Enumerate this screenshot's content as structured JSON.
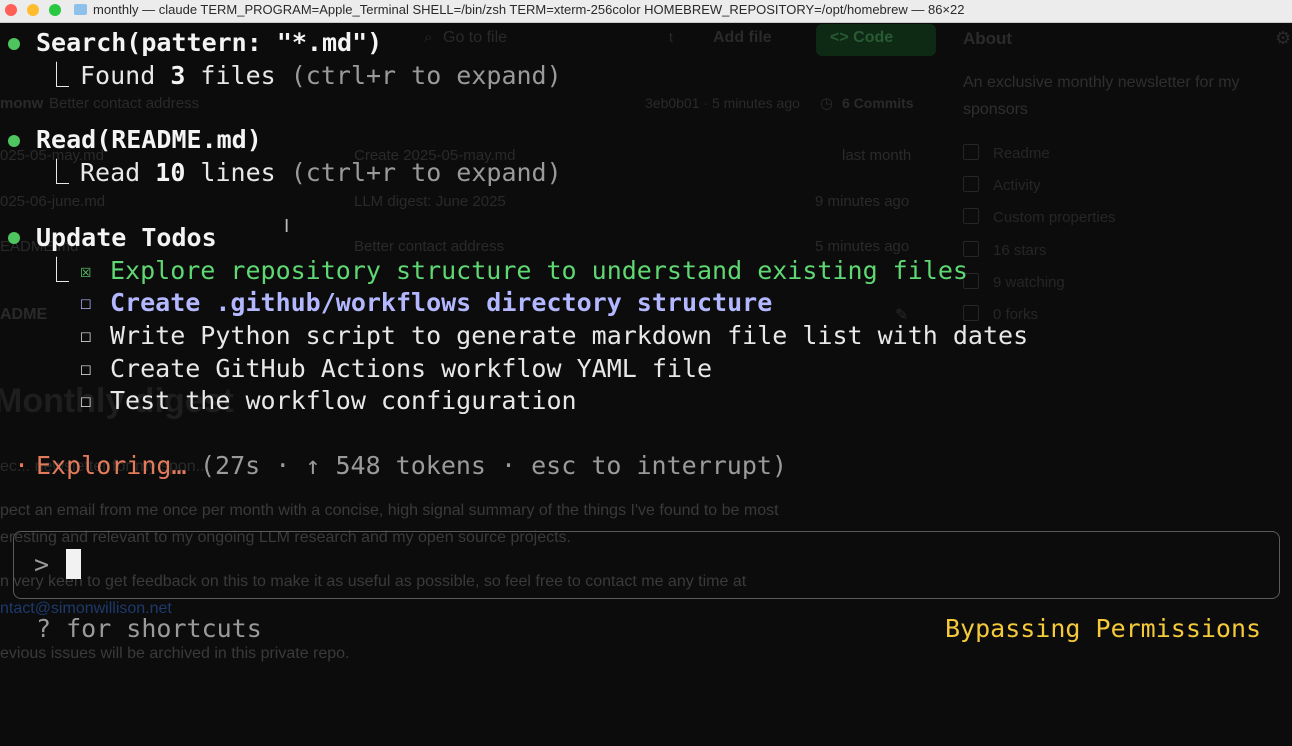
{
  "window": {
    "title": "monthly — claude TERM_PROGRAM=Apple_Terminal SHELL=/bin/zsh TERM=xterm-256color HOMEBREW_REPOSITORY=/opt/homebrew — 86×22"
  },
  "background_github": {
    "go_to_file": "Go to file",
    "shortcut_key": "t",
    "add_file": "Add file",
    "code_button": "<> Code",
    "branch_fragment": "monw",
    "commit_message": "Better contact address",
    "commit_hash_time": "3eb0b01 · 5 minutes ago",
    "commits": "6 Commits",
    "files": [
      {
        "name": "025-05-may.md",
        "message": "Create 2025-05-may.md",
        "time": "last month"
      },
      {
        "name": "025-06-june.md",
        "message": "LLM digest: June 2025",
        "time": "9 minutes ago"
      },
      {
        "name": "EADME.md",
        "message": "Better contact address",
        "time": "5 minutes ago"
      }
    ],
    "readme_tab": "ADME",
    "heading": "Monthly digest",
    "para1_fragment": "ec... newsletter for my spon...",
    "para2a": "pect an email from me once per month with a concise, high signal summary of the things I've found to be most",
    "para2b": "eresting and relevant to my ongoing LLM research and my open source projects.",
    "para3": "n very keen to get feedback on this to make it as useful as possible, so feel free to contact me any time at",
    "email": "ntact@simonwillison.net",
    "para4": "evious issues will be archived in this private repo.",
    "about": {
      "title": "About",
      "description": "An exclusive monthly newsletter for my sponsors",
      "items": [
        "Readme",
        "Activity",
        "Custom properties",
        "16 stars",
        "9 watching",
        "0 forks"
      ]
    }
  },
  "terminal": {
    "search_call": "Search(pattern: \"*.md\")",
    "search_result_prefix": "Found ",
    "search_result_count": "3",
    "search_result_suffix": " files ",
    "search_hint": "(ctrl+r to expand)",
    "read_call": "Read(README.md)",
    "read_result_prefix": "Read ",
    "read_result_count": "10",
    "read_result_suffix": " lines ",
    "read_hint": "(ctrl+r to expand)",
    "todos_title": "Update Todos",
    "tree_glyph": "⎿",
    "checked_box": "☒",
    "unchecked_box": "☐",
    "todos": [
      {
        "text": "Explore repository structure to understand existing files",
        "status": "done"
      },
      {
        "text": "Create .github/workflows directory structure",
        "status": "in_progress"
      },
      {
        "text": "Write Python script to generate markdown file list with dates",
        "status": "pending"
      },
      {
        "text": "Create GitHub Actions workflow YAML file",
        "status": "pending"
      },
      {
        "text": "Test the workflow configuration",
        "status": "pending"
      }
    ],
    "status_prefix": "·",
    "status_word": "Exploring…",
    "status_detail": "(27s · ↑ 548 tokens · esc to interrupt)",
    "prompt_symbol": ">",
    "shortcuts_hint": "? for shortcuts",
    "mode_label": "Bypassing Permissions"
  },
  "colors": {
    "dot_green": "#4ec55e",
    "done_green": "#5fd772",
    "in_progress_purple": "#b3b7ff",
    "status_orange": "#e37b5b",
    "mode_yellow": "#f4c93a"
  }
}
